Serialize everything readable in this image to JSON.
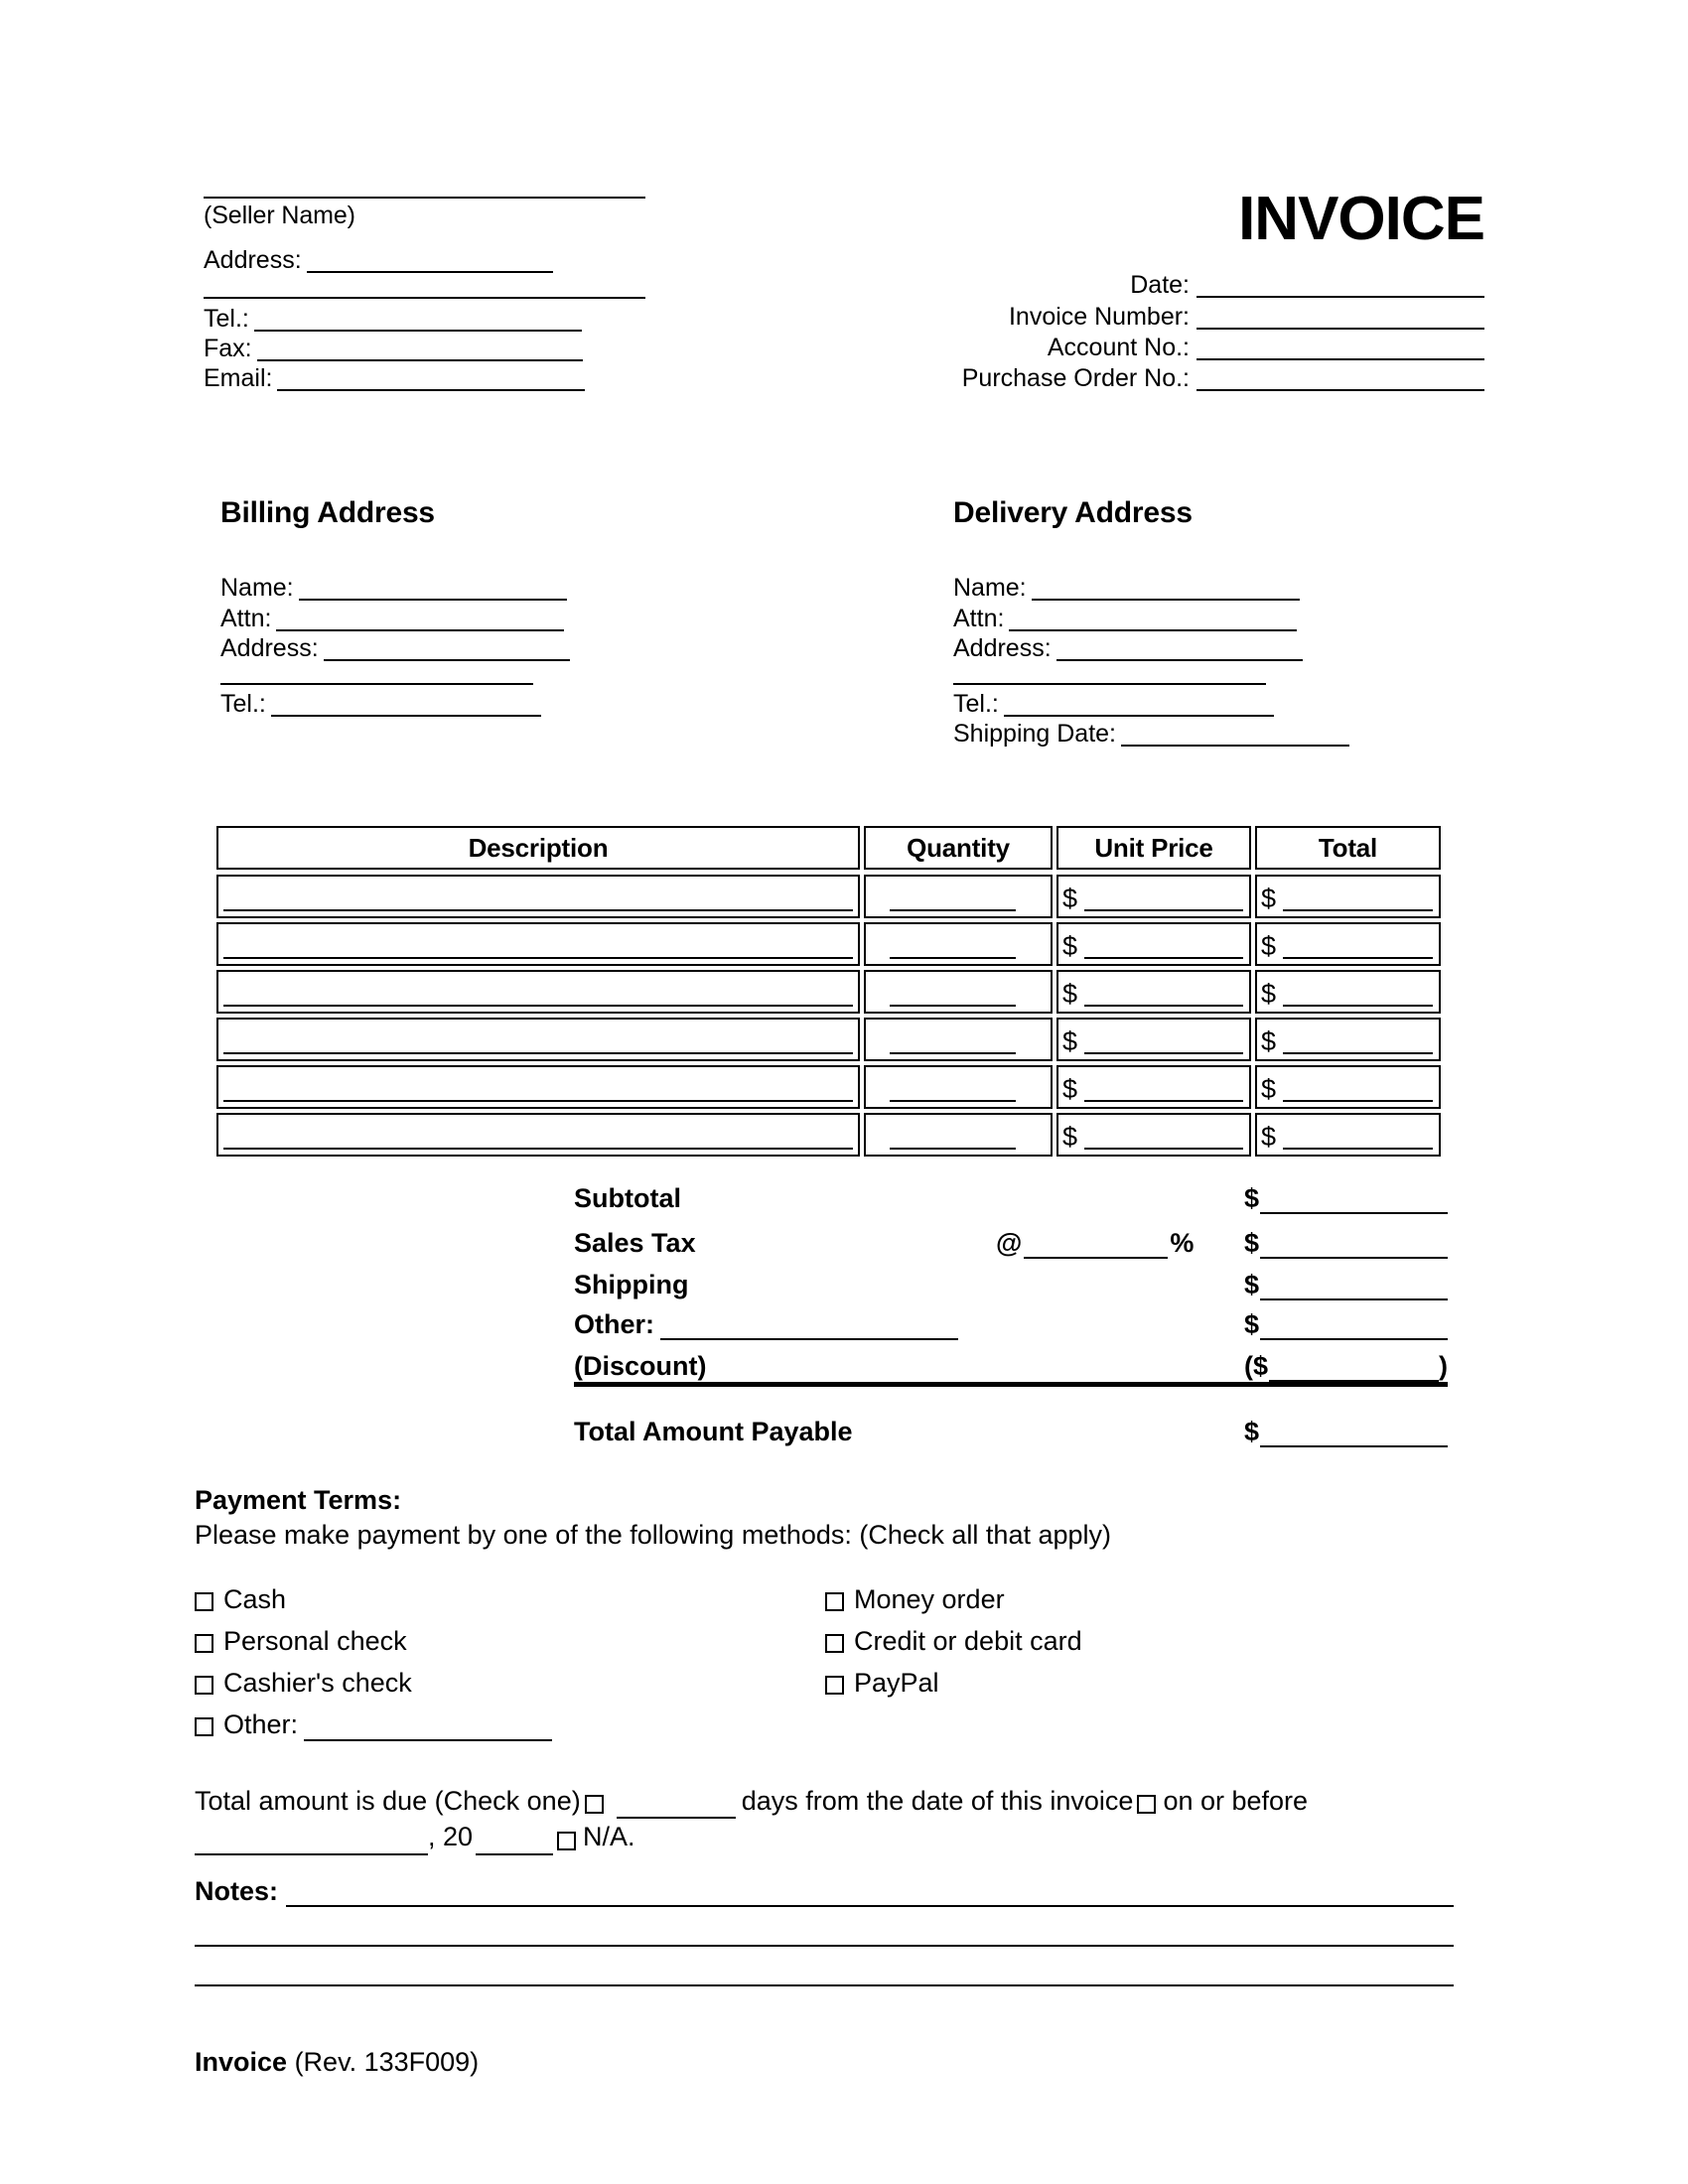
{
  "document": {
    "title": "INVOICE",
    "footer_bold": "Invoice",
    "footer_rest": "(Rev. 133F009)"
  },
  "seller": {
    "name_caption": "(Seller Name)",
    "address_label": "Address:",
    "tel_label": "Tel.:",
    "fax_label": "Fax:",
    "email_label": "Email:"
  },
  "meta": {
    "date_label": "Date:",
    "invoice_number_label": "Invoice Number:",
    "account_no_label": "Account No.:",
    "purchase_order_no_label": "Purchase Order No.:"
  },
  "billing": {
    "heading": "Billing Address",
    "name_label": "Name:",
    "attn_label": "Attn:",
    "address_label": "Address:",
    "tel_label": "Tel.:"
  },
  "delivery": {
    "heading": "Delivery Address",
    "name_label": "Name:",
    "attn_label": "Attn:",
    "address_label": "Address:",
    "tel_label": "Tel.:",
    "shipping_date_label": "Shipping Date:"
  },
  "items_table": {
    "columns": [
      "Description",
      "Quantity",
      "Unit Price",
      "Total"
    ],
    "currency_symbol": "$",
    "row_count": 6,
    "rows": [
      {
        "description": "",
        "quantity": "",
        "unit_price": "",
        "total": ""
      },
      {
        "description": "",
        "quantity": "",
        "unit_price": "",
        "total": ""
      },
      {
        "description": "",
        "quantity": "",
        "unit_price": "",
        "total": ""
      },
      {
        "description": "",
        "quantity": "",
        "unit_price": "",
        "total": ""
      },
      {
        "description": "",
        "quantity": "",
        "unit_price": "",
        "total": ""
      },
      {
        "description": "",
        "quantity": "",
        "unit_price": "",
        "total": ""
      }
    ]
  },
  "totals": {
    "subtotal_label": "Subtotal",
    "sales_tax_label": "Sales Tax",
    "sales_tax_at": "@",
    "sales_tax_percent_symbol": "%",
    "shipping_label": "Shipping",
    "other_label": "Other:",
    "discount_label": "(Discount)",
    "total_amount_payable_label": "Total Amount Payable",
    "currency_symbol": "$",
    "discount_open_paren": "($",
    "discount_close_paren": ")",
    "subtotal_value": "",
    "sales_tax_rate": "",
    "sales_tax_value": "",
    "shipping_value": "",
    "other_value": "",
    "discount_value": "",
    "total_amount_payable_value": ""
  },
  "payment_terms": {
    "title": "Payment Terms:",
    "subtitle": "Please make payment by one of the following methods: (Check all that apply)",
    "methods_left": [
      {
        "label": "Cash",
        "checked": false
      },
      {
        "label": "Personal check",
        "checked": false
      },
      {
        "label": "Cashier's check",
        "checked": false
      },
      {
        "label": "Other:",
        "checked": false,
        "has_blank": true
      }
    ],
    "methods_right": [
      {
        "label": "Money order",
        "checked": false
      },
      {
        "label": "Credit or debit card",
        "checked": false
      },
      {
        "label": "PayPal",
        "checked": false
      }
    ],
    "due": {
      "lead": "Total amount is due (Check one)",
      "days_suffix": "days from the date of this invoice",
      "on_or_before": "on or before",
      "year_prefix": ", 20",
      "na": "N/A.",
      "days_value": "",
      "date_value": "",
      "year_value": ""
    }
  },
  "notes": {
    "label": "Notes:",
    "value": "",
    "line_count": 3
  }
}
